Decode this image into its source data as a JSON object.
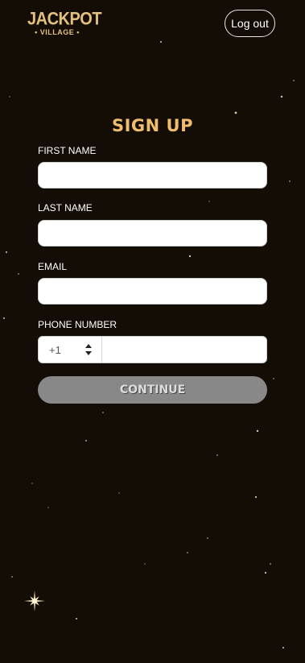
{
  "header": {
    "logo_line1": "JACKPOT",
    "logo_line2": "• VILLAGE •",
    "logout_label": "Log out"
  },
  "form": {
    "title": "SIGN UP",
    "first_name": {
      "label": "FIRST NAME",
      "value": ""
    },
    "last_name": {
      "label": "LAST NAME",
      "value": ""
    },
    "email": {
      "label": "EMAIL",
      "value": ""
    },
    "phone": {
      "label": "PHONE NUMBER",
      "country_code": "+1",
      "value": ""
    },
    "continue_label": "CONTINUE"
  },
  "colors": {
    "background": "#140d05",
    "accent": "#efbd70",
    "button_disabled": "#888888"
  }
}
